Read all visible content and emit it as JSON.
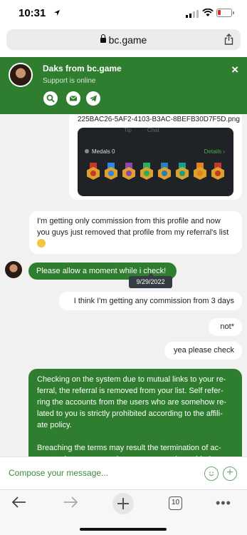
{
  "status_bar": {
    "time": "10:31"
  },
  "browser": {
    "url": "bc.game",
    "tab_count": "10"
  },
  "chat_header": {
    "agent_name": "Daks from bc.game",
    "agent_status": "Support is online",
    "close_label": "×"
  },
  "image_attachment": {
    "file_name": "225BAC26-5AF2-4103-B3AC-8BEFB30D7F5D.png",
    "tabs": [
      "Tip",
      "Chat"
    ],
    "medals_label": "Medals",
    "medals_count": "0",
    "details_label": "Details",
    "medal_colors": [
      "#c0392b",
      "#2e86de",
      "#8e44ad",
      "#27ae60",
      "#2980b9",
      "#16a085",
      "#e67e22",
      "#c0392b"
    ]
  },
  "messages": {
    "m1": "I'm getting only commission from this profile and now you guys just removed that profile from my referral's list",
    "m2": "Please allow a moment while i check!",
    "date_tooltip": "9/29/2022",
    "m3": "I think I'm getting any commission from 3 days",
    "m4": "not*",
    "m5": "yea please check",
    "m6_p1": "Checking on the system due to mutual links to your re-ferral, the referral is removed from your list. Self refer-ring the accounts from the users who are somehow re-lated to you is strictly prohibited according to the affili-ate policy.",
    "m6_p2": "Breaching the terms may result the termination of ac-counts, however we value our users and considering"
  },
  "compose": {
    "placeholder": "Compose your message..."
  },
  "colors": {
    "brand_green": "#2f7d2f",
    "chat_bg": "#f1f1f1"
  }
}
